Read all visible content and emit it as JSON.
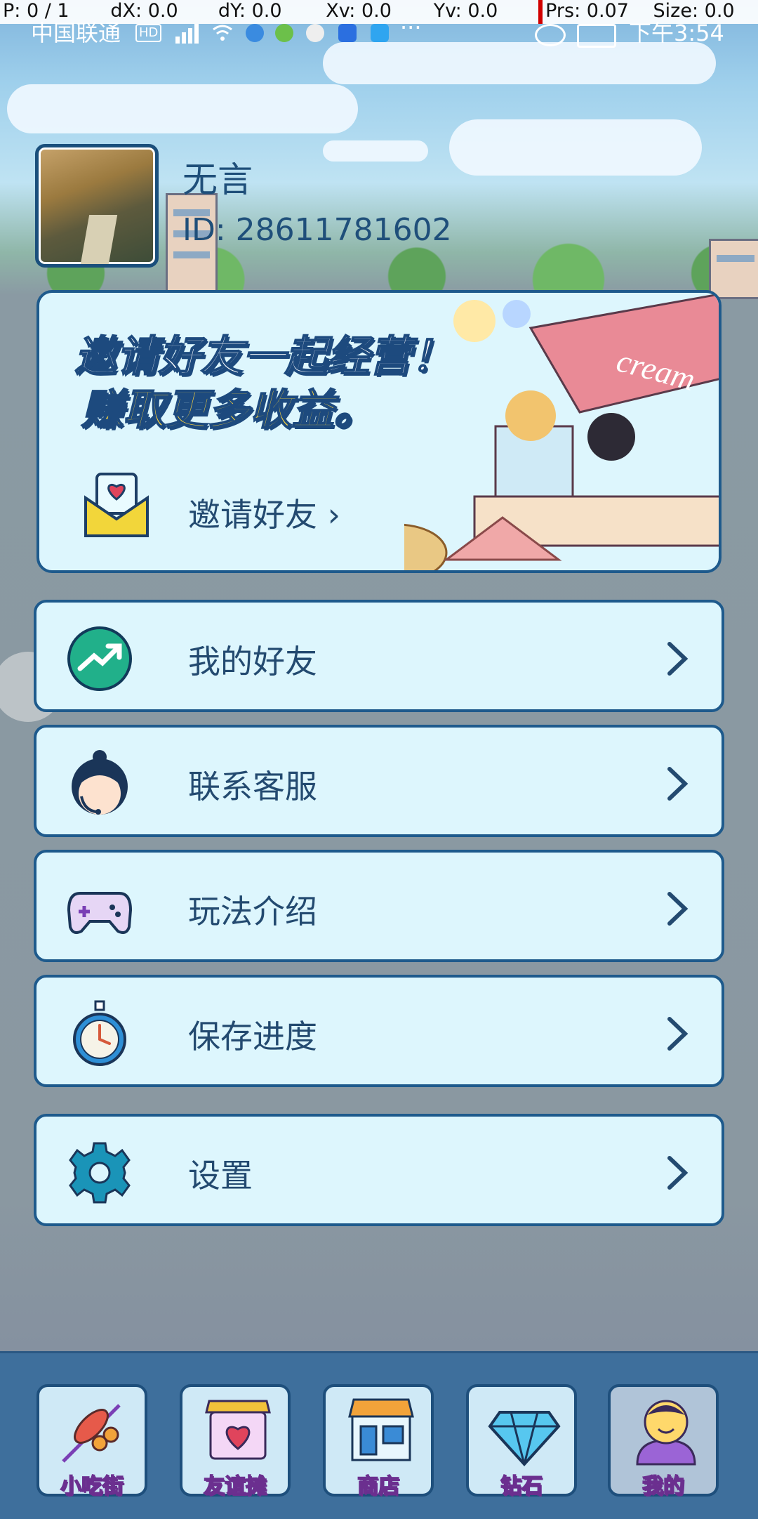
{
  "debug_bar": {
    "p": "P: 0 / 1",
    "dx": "dX: 0.0",
    "dy": "dY: 0.0",
    "xv": "Xv: 0.0",
    "yv": "Yv: 0.0",
    "prs": "Prs: 0.07",
    "size": "Size: 0.0"
  },
  "status_bar": {
    "carrier": "中国联通",
    "network_badge": "HD",
    "time": "下午3:54"
  },
  "profile": {
    "name": "无言",
    "id": "ID: 28611781602"
  },
  "invite_banner": {
    "headline": "邀请好友一起经营！",
    "subline": "赚取更多收益。",
    "link_label": "邀请好友",
    "stall_sign": "cream"
  },
  "menu": [
    {
      "label": "我的好友",
      "icon": "trend-up-icon"
    },
    {
      "label": "联系客服",
      "icon": "customer-service-icon"
    },
    {
      "label": "玩法介绍",
      "icon": "gamepad-icon"
    },
    {
      "label": "保存进度",
      "icon": "stopwatch-icon"
    },
    {
      "label": "设置",
      "icon": "gear-icon"
    }
  ],
  "bottom_nav": [
    {
      "label": "小吃街",
      "icon": "skewer-icon"
    },
    {
      "label": "友谊摊",
      "icon": "heart-stall-icon"
    },
    {
      "label": "商店",
      "icon": "shop-icon"
    },
    {
      "label": "钻石",
      "icon": "diamond-icon"
    },
    {
      "label": "我的",
      "icon": "user-face-icon",
      "active": true
    }
  ],
  "colors": {
    "card_bg": "#ddf6fd",
    "card_border": "#1e5a8c",
    "text": "#234a70",
    "banner_yellow": "#ffd63b",
    "nav_bg": "#3e6f9c"
  }
}
